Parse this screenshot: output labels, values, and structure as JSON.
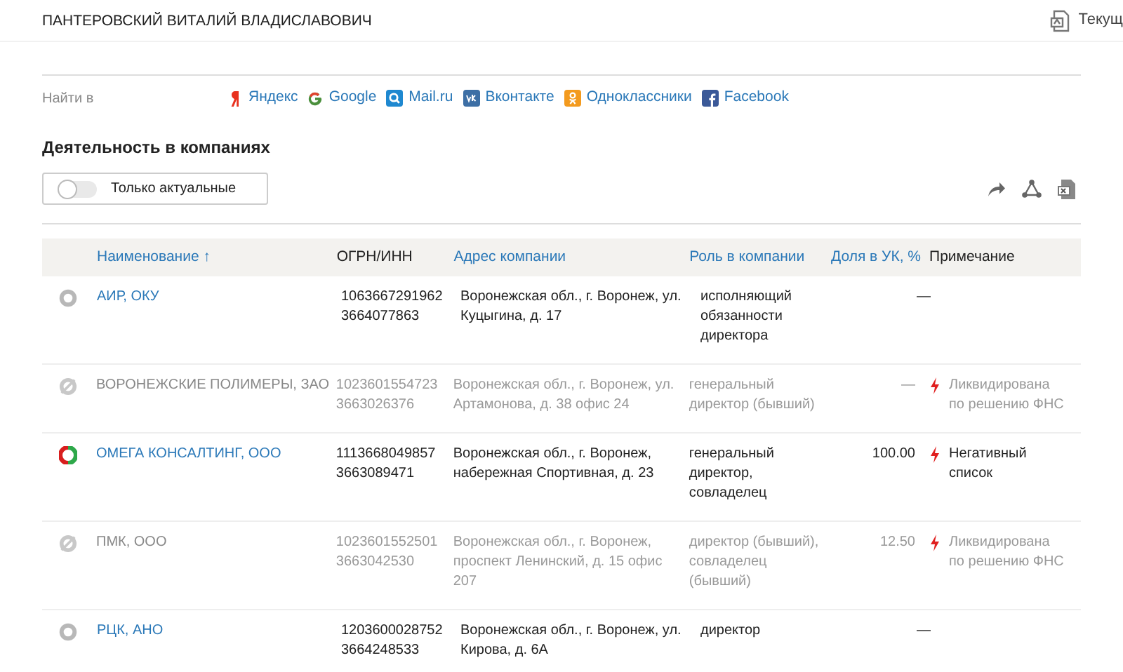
{
  "person": {
    "name": "ПАНТЕРОВСКИЙ ВИТАЛИЙ ВЛАДИСЛАВОВИЧ",
    "action": "Текущ"
  },
  "search": {
    "label": "Найти в",
    "links": [
      {
        "kind": "yandex",
        "label": "Яндекс"
      },
      {
        "kind": "google",
        "label": "Google"
      },
      {
        "kind": "mail",
        "label": "Mail.ru"
      },
      {
        "kind": "vk",
        "label": "Вконтакте"
      },
      {
        "kind": "ok",
        "label": "Одноклассники"
      },
      {
        "kind": "facebook",
        "label": "Facebook"
      }
    ]
  },
  "section": {
    "title": "Деятельность в компаниях",
    "filter": {
      "label": "Только актуальные",
      "on": false
    }
  },
  "table": {
    "columns": [
      {
        "label": "Наименование",
        "sortable": true,
        "sort_mark": "↑"
      },
      {
        "label": "ОГРН/ИНН",
        "sortable": false
      },
      {
        "label": "Адрес компании",
        "sortable": true
      },
      {
        "label": "Роль в компании",
        "sortable": true
      },
      {
        "label": "Доля в УК, %",
        "sortable": true
      },
      {
        "label": "Примечание",
        "sortable": false
      }
    ],
    "rows": [
      {
        "kind": "neutral",
        "active": true,
        "name": "АИР, ОКУ",
        "ogrn": "1063667291962",
        "inn": "3664077863",
        "address": "Воронежская обл., г. Воронеж, ул. Куцыгина, д. 17",
        "role": "исполняющий обязанности директора",
        "share": "—"
      },
      {
        "kind": "liquidated",
        "active": false,
        "name": "ВОРОНЕЖСКИЕ ПОЛИМЕРЫ, ЗАО",
        "ogrn": "1023601554723",
        "inn": "3663026376",
        "address": "Воронежская обл., г. Воронеж, ул. Артамонова, д. 38 офис 24",
        "role": "генеральный директор (бывший)",
        "share": "—",
        "note": {
          "text": "Ликвидирована по решению ФНС",
          "alert": true
        }
      },
      {
        "kind": "risk",
        "active": true,
        "name": "ОМЕГА КОНСАЛТИНГ, ООО",
        "ogrn": "1113668049857",
        "inn": "3663089471",
        "address": "Воронежская обл., г. Воронеж, набережная Спортивная, д. 23",
        "role": "генеральный директор, совладелец",
        "share": "100.00",
        "note": {
          "text": "Негативный список",
          "alert": true
        }
      },
      {
        "kind": "liquidated",
        "active": false,
        "name": "ПМК, ООО",
        "ogrn": "1023601552501",
        "inn": "3663042530",
        "address": "Воронежская обл., г. Воронеж, проспект Ленинский, д. 15 офис 207",
        "role": "директор (бывший), совладелец (бывший)",
        "share": "12.50",
        "note": {
          "text": "Ликвидирована по решению ФНС",
          "alert": true
        }
      },
      {
        "kind": "neutral",
        "active": true,
        "name": "РЦК, АНО",
        "ogrn": "1203600028752",
        "inn": "3664248533",
        "address": "Воронежская обл., г. Воронеж, ул. Кирова, д. 6А",
        "role": "директор",
        "share": "—"
      }
    ]
  }
}
